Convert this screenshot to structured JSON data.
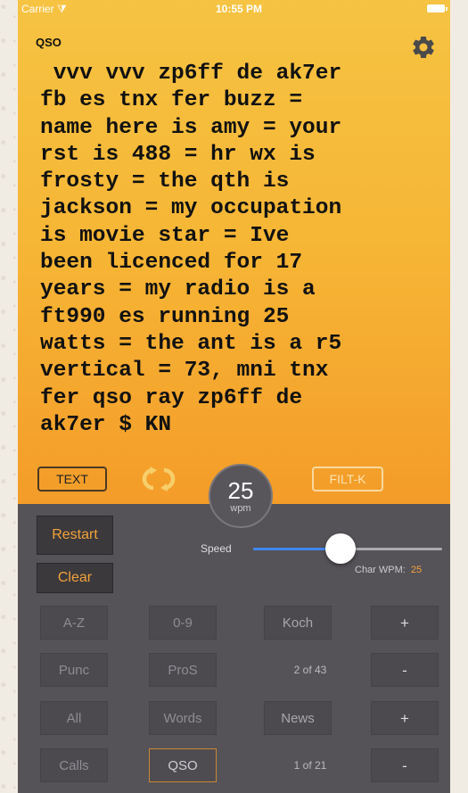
{
  "status_bar": {
    "carrier": "Carrier",
    "time": "10:55 PM"
  },
  "mode_title": "QSO",
  "icons": {
    "settings": "gear-icon",
    "wifi": "wifi-icon",
    "battery": "battery-icon",
    "repeat": "repeat-icon"
  },
  "qso_text": " vvv vvv zp6ff de ak7er\nfb es tnx fer buzz =\nname here is amy = your\nrst is 488 = hr wx is\nfrosty = the qth is\njackson = my occupation\nis movie star = Ive\nbeen licenced for 17\nyears = my radio is a\nft990 es running 25\nwatts = the ant is a r5\nvertical = 73, mni tnx\nfer qso ray zp6ff de\nak7er $ KN",
  "controls": {
    "text_label": "TEXT",
    "filt_label": "FILT-K",
    "wpm_value": "25",
    "wpm_unit": "wpm"
  },
  "actions": {
    "restart": "Restart",
    "clear": "Clear"
  },
  "speed": {
    "label": "Speed",
    "char_wpm_label": "Char WPM:",
    "char_wpm_value": "25",
    "slider_fraction": 0.46
  },
  "grid": {
    "row1": {
      "a": "A-Z",
      "b": "0-9",
      "c": "Koch",
      "plus": "+"
    },
    "row2": {
      "a": "Punc",
      "b": "ProS",
      "c": "2 of 43",
      "minus": "-"
    },
    "row3": {
      "a": "All",
      "b": "Words",
      "c": "News",
      "plus": "+"
    },
    "row4": {
      "a": "Calls",
      "b": "QSO",
      "c": "1 of 21",
      "minus": "-"
    }
  },
  "colors": {
    "accent": "#f3a23a",
    "top_gradient_start": "#f6c342",
    "top_gradient_end": "#f49c29",
    "panel": "#555258",
    "slider_blue": "#3f86ee"
  }
}
